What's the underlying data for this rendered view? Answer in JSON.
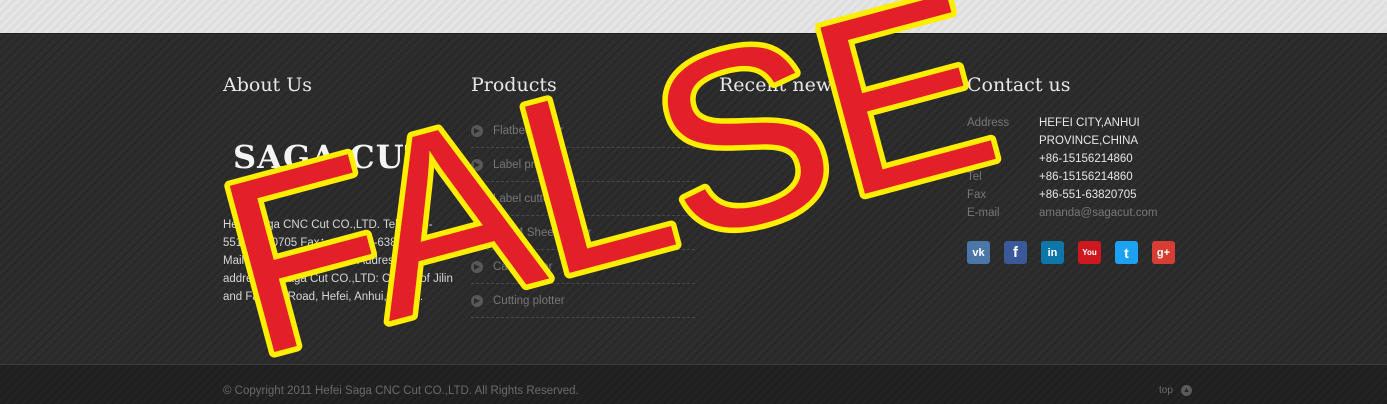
{
  "columns": {
    "about": {
      "title": "About Us"
    },
    "products": {
      "title": "Products"
    },
    "recent_news": {
      "title": "Recent news"
    },
    "contact": {
      "title": "Contact us"
    }
  },
  "about": {
    "logo_text": "SAGA CUT",
    "description": "Hefei Saga CNC Cut CO.,LTD. Tel：+86-551-63820705 Fax：+86-551-63820705 E-Mail：yyandqe@163.com Address: New address of Saga Cut CO.,LTD: Corner of Jilin and Fanhua Road, Hefei, Anhui, China."
  },
  "products": {
    "items": [
      {
        "label": "Flatbed cutter",
        "icon": "circle-arrow-right-icon"
      },
      {
        "label": "Label printer",
        "icon": "circle-arrow-right-icon"
      },
      {
        "label": "Label cutter",
        "icon": "circle-arrow-right-icon"
      },
      {
        "label": "A3 A4 Sheet Cutter",
        "icon": "circle-arrow-right-icon"
      },
      {
        "label": "Card Cutter",
        "icon": "circle-arrow-right-icon"
      },
      {
        "label": "Cutting plotter",
        "icon": "circle-arrow-right-icon"
      }
    ]
  },
  "contact": {
    "rows": [
      {
        "label": "Address",
        "value": "HEFEI CITY,ANHUI PROVINCE,CHINA"
      },
      {
        "label": "Mobile",
        "value": "+86-15156214860"
      },
      {
        "label": "Tel",
        "value": "+86-15156214860"
      },
      {
        "label": "Fax",
        "value": "+86-551-63820705"
      },
      {
        "label": "E-mail",
        "value": "amanda@sagacut.com"
      }
    ],
    "socials": [
      {
        "name": "vk",
        "glyph": "vk",
        "color": "#4a76a8"
      },
      {
        "name": "facebook",
        "glyph": "f",
        "color": "#3b5998"
      },
      {
        "name": "linkedin",
        "glyph": "in",
        "color": "#0e76a8"
      },
      {
        "name": "youtube",
        "glyph": "You",
        "color": "#cc181e"
      },
      {
        "name": "twitter",
        "glyph": "t",
        "color": "#1da1f2"
      },
      {
        "name": "google-plus",
        "glyph": "g+",
        "color": "#d73d32"
      }
    ]
  },
  "bottom": {
    "copyright": "© Copyright 2011 Hefei Saga CNC Cut CO.,LTD. All Rights Reserved.",
    "top_label": "top"
  },
  "overlay": {
    "stamp_text": "FALSE",
    "fill": "#e3202a",
    "stroke": "#ffee00"
  }
}
